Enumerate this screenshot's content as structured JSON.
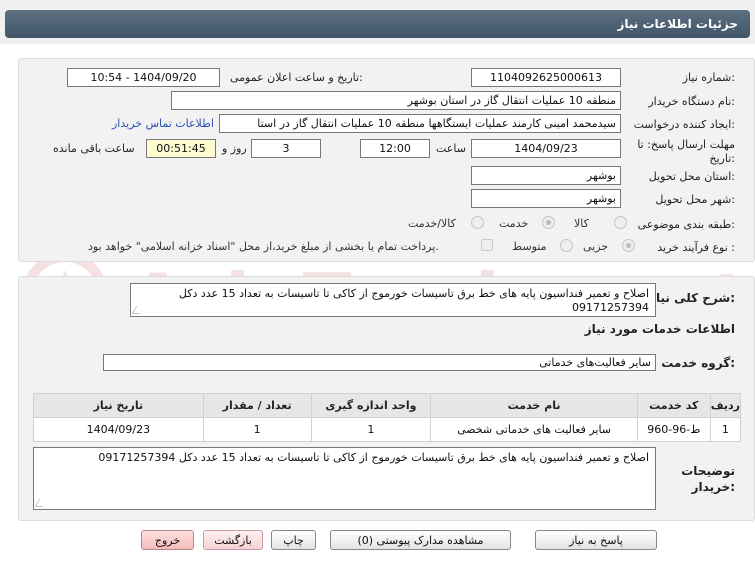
{
  "header": {
    "title": "جزئیات اطلاعات نیاز"
  },
  "info": {
    "need_number_label": "شماره نیاز:",
    "need_number": "1104092625000613",
    "announce_label": "تاریخ و ساعت اعلان عمومی:",
    "announce_value": "1404/09/20 - 10:54",
    "buyer_label": "نام دستگاه خریدار:",
    "buyer_value": "منطقه 10 عملیات انتقال گاز در استان بوشهر",
    "creator_label": "ایجاد کننده درخواست:",
    "creator_value": "سیدمحمد امینی کارمند عملیات ایستگاهها منطقه 10 عملیات انتقال گاز در استا",
    "contact_link": "اطلاعات تماس خریدار",
    "deadline_label_line1": "مهلت ارسال پاسخ: تا",
    "deadline_label_line2": "تاریخ:",
    "deadline_date": "1404/09/23",
    "time_label": "ساعت",
    "deadline_time": "12:00",
    "days_value": "3",
    "days_label": "روز و",
    "remaining_time": "00:51:45",
    "remaining_label": "ساعت باقی مانده",
    "province_label": "استان محل تحویل:",
    "province_value": "بوشهر",
    "city_label": "شهر محل تحویل:",
    "city_value": "بوشهر",
    "category_label": "طبقه بندی موضوعی:",
    "category_options": [
      "کالا",
      "خدمت",
      "کالا/خدمت"
    ],
    "category_selected": "خدمت",
    "process_label": "نوع فرآیند خرید :",
    "process_options": [
      "جزیی",
      "متوسط"
    ],
    "process_note": "پرداخت تمام یا بخشی از مبلغ خرید،از محل \"اسناد خزانه اسلامی\" خواهد بود."
  },
  "summary": {
    "label": "شرح کلی نیاز:",
    "text": "اصلاح و تعمیر فنداسیون پایه های خط برق تاسیسات خورموج از کاکی تا تاسیسات به تعداد 15 عدد دکل 09171257394"
  },
  "services": {
    "section_title": "اطلاعات خدمات مورد نیاز",
    "group_label": "گروه خدمت:",
    "group_value": "سایر فعالیت‌های خدماتی",
    "columns": [
      "ردیف",
      "کد خدمت",
      "نام خدمت",
      "واحد اندازه گیری",
      "تعداد / مقدار",
      "تاریخ نیاز"
    ],
    "rows": [
      {
        "row": "1",
        "code": "ط-96-960",
        "name": "سایر فعالیت های خدماتی شخصی",
        "unit": "1",
        "qty": "1",
        "date": "1404/09/23"
      }
    ]
  },
  "buyer_notes": {
    "label_line1": "توضیحات",
    "label_line2": "خریدار:",
    "text": "اصلاح و تعمیر فنداسیون پایه های خط برق تاسیسات خورموج از کاکی تا تاسیسات به تعداد 15 عدد دکل 09171257394"
  },
  "buttons": {
    "reply": "پاسخ به نیاز",
    "attachments": "مشاهده مدارک پیوستی (0)",
    "print": "چاپ",
    "back": "بازگشت",
    "exit": "خروج"
  },
  "watermark": {
    "text": "AriaTender.net"
  }
}
